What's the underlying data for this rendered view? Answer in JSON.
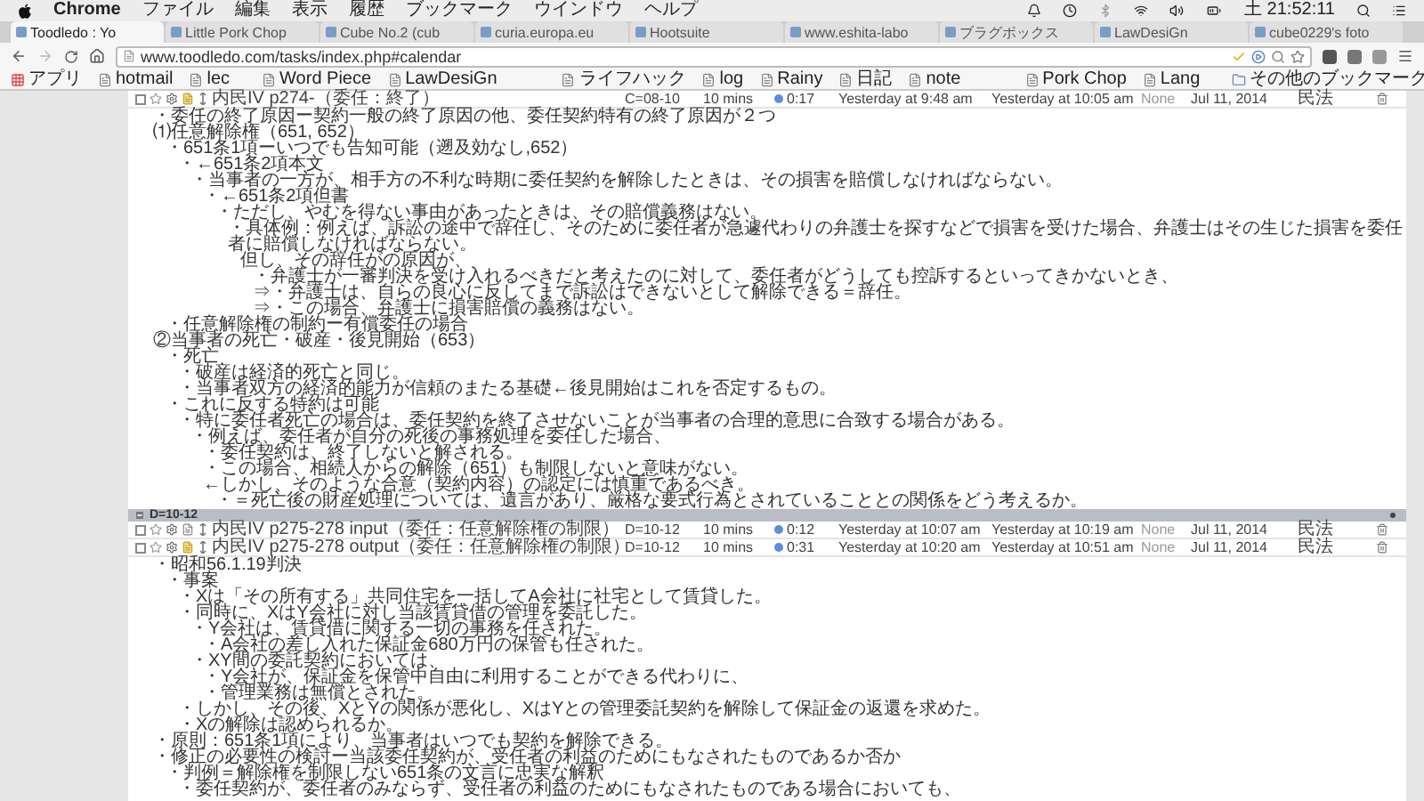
{
  "menu_bar": {
    "app": "Chrome",
    "menus": [
      "ファイル",
      "編集",
      "表示",
      "履歴",
      "ブックマーク",
      "ウインドウ",
      "ヘルプ"
    ],
    "clock": "土 21:52:11"
  },
  "tabs": [
    {
      "title": "Toodledo : Yo",
      "selected": true
    },
    {
      "title": "Little Pork Chop",
      "selected": false
    },
    {
      "title": "Cube No.2 (cub",
      "selected": false
    },
    {
      "title": "curia.europa.eu",
      "selected": false
    },
    {
      "title": "Hootsuite",
      "selected": false
    },
    {
      "title": "www.eshita-labo",
      "selected": false
    },
    {
      "title": "ブラグボックス",
      "selected": false
    },
    {
      "title": "LawDesiGn",
      "selected": false
    },
    {
      "title": "cube0229's foto",
      "selected": false
    }
  ],
  "address_bar": {
    "url": "www.toodledo.com/tasks/index.php#calendar"
  },
  "bookmarks": [
    {
      "kind": "apps",
      "label": "アプリ"
    },
    {
      "kind": "link",
      "label": "hotmail"
    },
    {
      "kind": "link",
      "label": "lec"
    },
    {
      "kind": "icon"
    },
    {
      "kind": "link",
      "label": "Word Piece"
    },
    {
      "kind": "link",
      "label": "LawDesiGn"
    },
    {
      "kind": "icon"
    },
    {
      "kind": "icon"
    },
    {
      "kind": "icon"
    },
    {
      "kind": "link",
      "label": "ライフハック"
    },
    {
      "kind": "link",
      "label": "log"
    },
    {
      "kind": "link",
      "label": "Rainy"
    },
    {
      "kind": "link",
      "label": "日記"
    },
    {
      "kind": "link",
      "label": "note"
    },
    {
      "kind": "icon"
    },
    {
      "kind": "icon"
    },
    {
      "kind": "icon"
    },
    {
      "kind": "link",
      "label": "Pork Chop"
    },
    {
      "kind": "link",
      "label": "Lang"
    }
  ],
  "other_bookmarks": "その他のブックマーク",
  "rows": [
    {
      "kind": "task",
      "title": "内民IV p274-（委任：終了）",
      "checked": false,
      "starred": false,
      "has_note": true,
      "context": "C=08-10",
      "length": "10 mins",
      "timer": "0:17",
      "started": "Yesterday at 9:48 am",
      "completed": "Yesterday at 10:05 am",
      "priority": "None",
      "due": "Jul 11, 2014",
      "tag": "民法",
      "note": [
        {
          "text": "・委任の終了原因ー契約一般の終了原因の他、委任契約特有の終了原因が２つ"
        },
        {
          "text": "⑴任意解除権（651, 652）",
          "children": [
            {
              "text": "・651条1項ーいつでも告知可能（遡及効なし,652）",
              "children": [
                {
                  "text": "・←651条2項本文",
                  "children": [
                    {
                      "text": "・当事者の一方が、相手方の不利な時期に委任契約を解除したときは、その損害を賠償しなければならない。",
                      "children": [
                        {
                          "text": "・←651条2項但書",
                          "children": [
                            {
                              "text": "・ただし、やむを得ない事由があったときは、その賠償義務はない。",
                              "children": [
                                {
                                  "text": "・具体例：例えば、訴訟の途中で辞任し、そのために委任者が急遽代わりの弁護士を探すなどで損害を受けた場合、弁護士はその生じた損害を委任者に賠償しなければならない。",
                                  "children": [
                                    {
                                      "text": "但し、その辞任がの原因が、",
                                      "children": [
                                        {
                                          "text": "・弁護士が一審判決を受け入れるべきだと考えたのに対して、委任者がどうしても控訴するといってきかないとき、"
                                        },
                                        {
                                          "text": "⇒・弁護士は、自らの良心に反してまで訴訟はできないとして解除できる＝辞任。"
                                        },
                                        {
                                          "text": "⇒・この場合、弁護士に損害賠償の義務はない。"
                                        }
                                      ]
                                    }
                                  ]
                                }
                              ]
                            }
                          ]
                        }
                      ]
                    }
                  ]
                }
              ]
            },
            {
              "text": "・任意解除権の制約ー有償委任の場合"
            }
          ]
        },
        {
          "text": "②当事者の死亡・破産・後見開始（653）",
          "children": [
            {
              "text": "・死亡",
              "children": [
                {
                  "text": "・破産は経済的死亡と同じ。"
                },
                {
                  "text": "・当事者双方の経済的能力が信頼のまたる基礎←後見開始はこれを否定するもの。"
                }
              ]
            },
            {
              "text": "・これに反する特約は可能",
              "children": [
                {
                  "text": "・特に委任者死亡の場合は、委任契約を終了させないことが当事者の合理的意思に合致する場合がある。",
                  "children": [
                    {
                      "text": "・例えば、委任者が自分の死後の事務処理を委任した場合、",
                      "children": [
                        {
                          "text": "・委任契約は、終了しないと解される。"
                        },
                        {
                          "text": "・この場合、相続人からの解除（651）も制限しないと意味がない。"
                        },
                        {
                          "text": "←しかし、そのような合意（契約内容）の認定には慎重であるべき。",
                          "children": [
                            {
                              "text": "・＝死亡後の財産処理については、遺言があり、厳格な要式行為とされていることとの関係をどう考えるか。"
                            }
                          ]
                        }
                      ]
                    }
                  ]
                }
              ]
            }
          ]
        }
      ]
    },
    {
      "kind": "group",
      "label": "D=10-12"
    },
    {
      "kind": "task",
      "title": "内民IV p275-278 input（委任：任意解除権の制限）",
      "checked": false,
      "starred": false,
      "has_note": false,
      "context": "D=10-12",
      "length": "10 mins",
      "timer": "0:12",
      "started": "Yesterday at 10:07 am",
      "completed": "Yesterday at 10:19 am",
      "priority": "None",
      "due": "Jul 11, 2014",
      "tag": "民法"
    },
    {
      "kind": "task",
      "title": "内民IV p275-278 output（委任：任意解除権の制限）",
      "checked": false,
      "starred": false,
      "has_note": true,
      "context": "D=10-12",
      "length": "10 mins",
      "timer": "0:31",
      "started": "Yesterday at 10:20 am",
      "completed": "Yesterday at 10:51 am",
      "priority": "None",
      "due": "Jul 11, 2014",
      "tag": "民法",
      "note": [
        {
          "text": "・昭和56.1.19判決",
          "children": [
            {
              "text": "・事案",
              "children": [
                {
                  "text": "・Xは「その所有する」共同住宅を一括してA会社に社宅として賃貸した。"
                },
                {
                  "text": "・同時に、XはY会社に対し当該賃貸借の管理を委託した。",
                  "children": [
                    {
                      "text": "・Y会社は、賃貸借に関する一切の事務を任された。",
                      "children": [
                        {
                          "text": "・A会社の差し入れた保証金680万円の保管も任された。"
                        }
                      ]
                    },
                    {
                      "text": "・XY間の委託契約においては、",
                      "children": [
                        {
                          "text": "・Y会社が、保証金を保管中自由に利用することができる代わりに、"
                        },
                        {
                          "text": "・管理業務は無償とされた。"
                        }
                      ]
                    }
                  ]
                },
                {
                  "text": "・しかし、その後、XとYの関係が悪化し、XはYとの管理委託契約を解除して保証金の返還を求めた。"
                },
                {
                  "text": "・Xの解除は認められるか。"
                }
              ]
            }
          ]
        },
        {
          "text": "・原則：651条1項により、当事者はいつでも契約を解除できる。"
        },
        {
          "text": "・修正の必要性の検討ー当該委任契約が、受任者の利益のためにもなされたものであるか否か",
          "children": [
            {
              "text": "・判例＝解除権を制限しない651条の文言に忠実な解釈",
              "children": [
                {
                  "text": "・委任契約が、委任者のみならず、受任者の利益のためにもなされたものである場合においても、"
                }
              ]
            }
          ]
        }
      ]
    }
  ]
}
